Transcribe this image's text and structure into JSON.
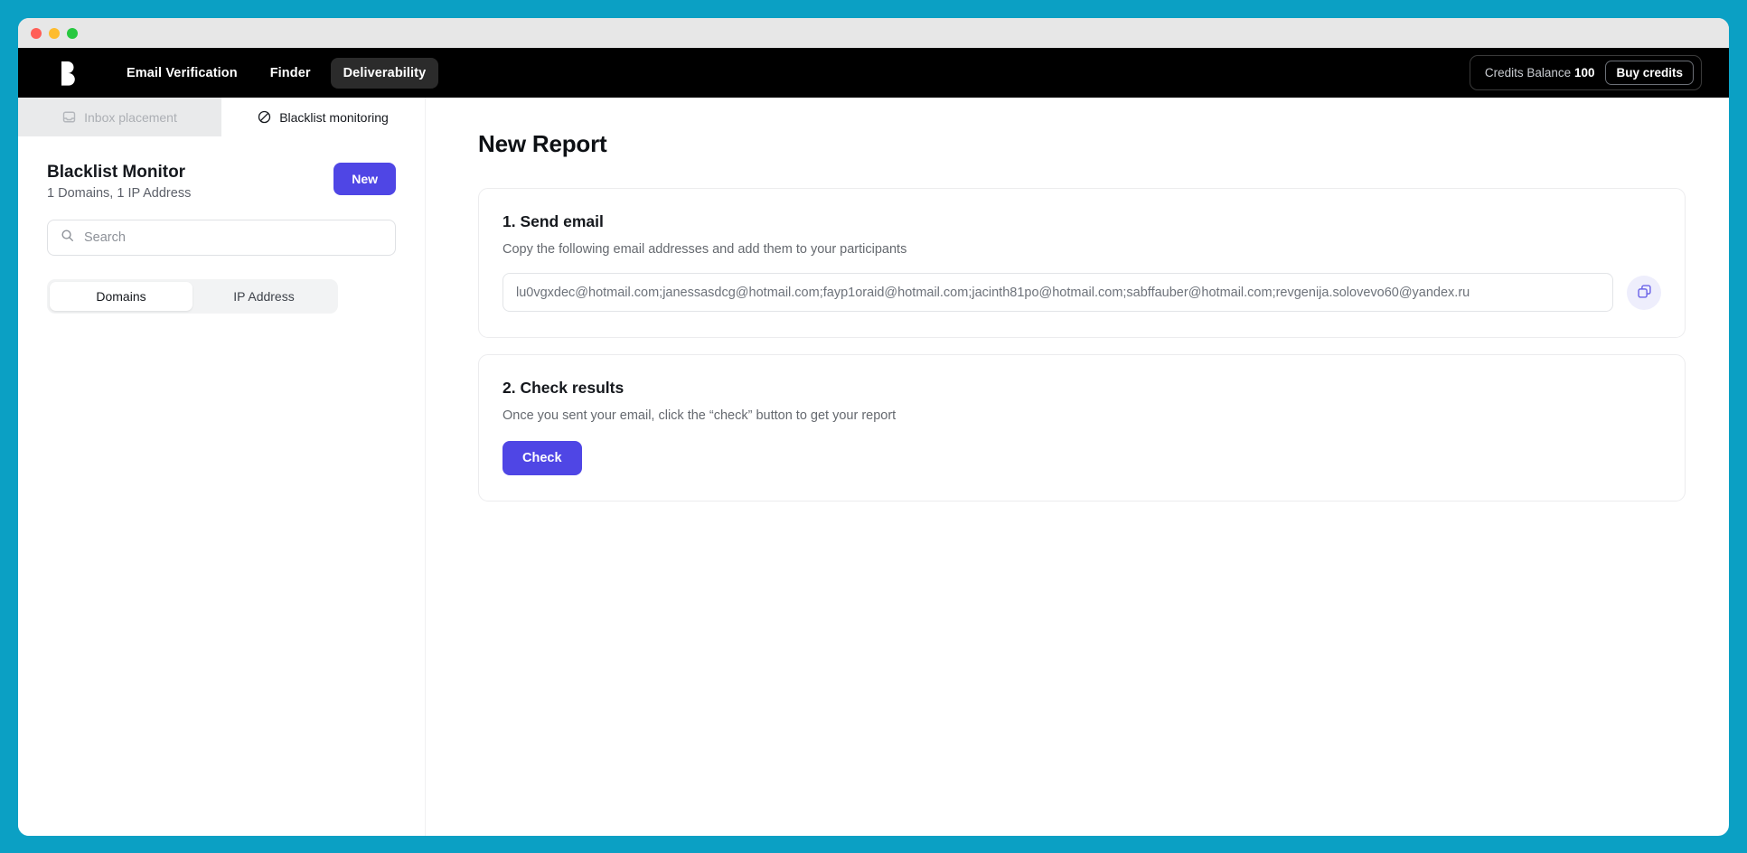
{
  "window": {
    "traffic_lights": [
      "close",
      "minimize",
      "zoom"
    ]
  },
  "topnav": {
    "logo_name": "brand-logo",
    "links": [
      {
        "label": "Email Verification",
        "active": false
      },
      {
        "label": "Finder",
        "active": false
      },
      {
        "label": "Deliverability",
        "active": true
      }
    ],
    "credits_text": "Credits Balance",
    "credits_value": "100",
    "buy_credits_label": "Buy credits"
  },
  "subtabs": [
    {
      "label": "Inbox placement",
      "icon": "inbox-icon",
      "state": "disabled"
    },
    {
      "label": "Blacklist monitoring",
      "icon": "ban-icon",
      "state": "active"
    }
  ],
  "sidebar": {
    "title": "Blacklist Monitor",
    "subtitle": "1 Domains, 1 IP Address",
    "new_button_label": "New",
    "search_placeholder": "Search",
    "search_value": "",
    "segments": [
      {
        "label": "Domains",
        "active": true
      },
      {
        "label": "IP Address",
        "active": false
      }
    ]
  },
  "main": {
    "page_title": "New Report",
    "steps": [
      {
        "title": "1. Send email",
        "description": "Copy the following email addresses and add them to your participants",
        "emails_value": "lu0vgxdec@hotmail.com;janessasdcg@hotmail.com;fayp1oraid@hotmail.com;jacinth81po@hotmail.com;sabffauber@hotmail.com;revgenija.solovevo60@yandex.ru",
        "copy_icon": "copy-icon"
      },
      {
        "title": "2. Check results",
        "description": "Once you sent your email, click the “check” button to get your report",
        "button_label": "Check"
      }
    ]
  },
  "colors": {
    "desktop_background": "#0BA0C4",
    "topnav_background": "#000000",
    "accent_purple": "#4F46E5",
    "copy_button_background": "#EEEEFC",
    "titlebar": "#E7E7E7"
  }
}
